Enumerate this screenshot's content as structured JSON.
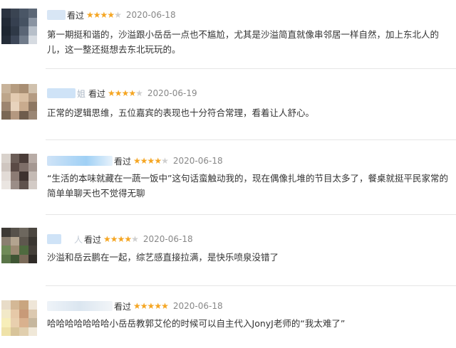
{
  "reviews": [
    {
      "watched_label": "看过",
      "rating": 4,
      "max_rating": 5,
      "date": "2020-06-18",
      "lines": [
        "第一期挺和谐的，沙溢跟小岳岳一点也不尴尬，尤其是沙溢简直就像串邻居一样自然，加上东北人的",
        "儿，这一整还挺想去东北玩玩的。"
      ]
    },
    {
      "watched_label": "看过",
      "name_fragment": "姐",
      "rating": 4,
      "max_rating": 5,
      "date": "2020-06-19",
      "lines": [
        "正常的逻辑思维，五位嘉宾的表现也十分符合常理，看着让人舒心。"
      ]
    },
    {
      "watched_label": "看过",
      "rating": 4,
      "max_rating": 5,
      "date": "2020-06-18",
      "lines": [
        "“生活的本味就藏在一蔬一饭中”这句话蛮触动我的，现在偶像扎堆的节目太多了，餐桌就挺平民家常的",
        "简单单聊天也不觉得无聊"
      ]
    },
    {
      "watched_label": "看过",
      "name_fragment": "人",
      "rating": 4,
      "max_rating": 5,
      "date": "2020-06-18",
      "lines": [
        "沙溢和岳云鹏在一起，综艺感直接拉满，是快乐喷泉没错了"
      ]
    },
    {
      "watched_label": "看过",
      "rating": 5,
      "max_rating": 5,
      "date": "2020-06-18",
      "lines": [
        "哈哈哈哈哈哈哈小岳岳教郭艾伦的时候可以自主代入JonyJ老师的“我太难了”"
      ]
    }
  ],
  "colors": {
    "star_on": "#f5a623",
    "star_off": "#cfcfcf",
    "divider": "#e6e6e6",
    "name_blur": "#cfe3f7"
  },
  "icons": {
    "star": "star-icon"
  }
}
